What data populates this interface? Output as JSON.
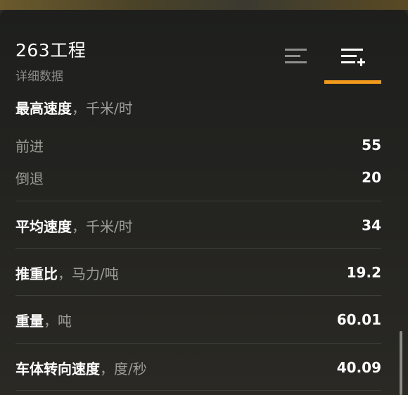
{
  "header": {
    "title": "263工程",
    "subtitle": "详细数据"
  },
  "tabs": [
    {
      "name": "basic-stats",
      "icon": "list-icon",
      "active": false
    },
    {
      "name": "detailed-stats",
      "icon": "list-add-icon",
      "active": true
    }
  ],
  "accent_color": "#f39a1c",
  "stats": {
    "max_speed": {
      "label": "最高速度",
      "unit": "，千米/时",
      "forward_label": "前进",
      "forward_value": "55",
      "reverse_label": "倒退",
      "reverse_value": "20"
    },
    "avg_speed": {
      "label": "平均速度",
      "unit": "，千米/时",
      "value": "34"
    },
    "power_weight": {
      "label": "推重比",
      "unit": "，马力/吨",
      "value": "19.2"
    },
    "weight": {
      "label": "重量",
      "unit": "，吨",
      "value": "60.01"
    },
    "traverse": {
      "label": "车体转向速度",
      "unit": "，度/秒",
      "value": "40.09"
    }
  }
}
